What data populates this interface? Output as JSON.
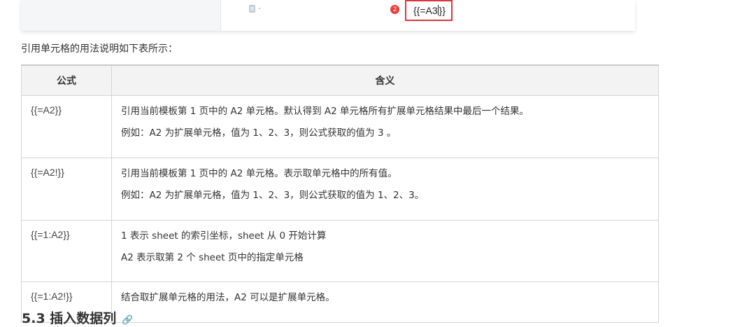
{
  "screenshot_fragment": {
    "badge_number": "2",
    "formula_text": "{{=A3}}"
  },
  "intro_text": "引用单元格的用法说明如下表所示：",
  "table": {
    "headers": [
      "公式",
      "含义"
    ],
    "rows": [
      {
        "formula": "{{=A2}}",
        "lines": [
          "引用当前模板第 1 页中的 A2 单元格。默认得到 A2 单元格所有扩展单元格结果中最后一个结果。",
          "例如：A2 为扩展单元格，值为 1、2、3，则公式获取的值为 3 。"
        ]
      },
      {
        "formula": "{{=A2!}}",
        "lines": [
          "引用当前模板第 1 页中的 A2 单元格。表示取单元格中的所有值。",
          "例如：A2 为扩展单元格，值为 1、2、3，则公式获取的值为 1、2、3。"
        ]
      },
      {
        "formula": "{{=1:A2}}",
        "lines": [
          "1 表示 sheet 的索引坐标，sheet 从 0 开始计算",
          "A2 表示取第 2 个 sheet 页中的指定单元格"
        ]
      },
      {
        "formula": "{{=1:A2!}}",
        "lines": [
          "结合取扩展单元格的用法，A2 可以是扩展单元格。"
        ]
      }
    ]
  },
  "section_heading": "5.3 插入数据列",
  "icons": {
    "anchor": "link-icon",
    "document": "document-icon"
  }
}
